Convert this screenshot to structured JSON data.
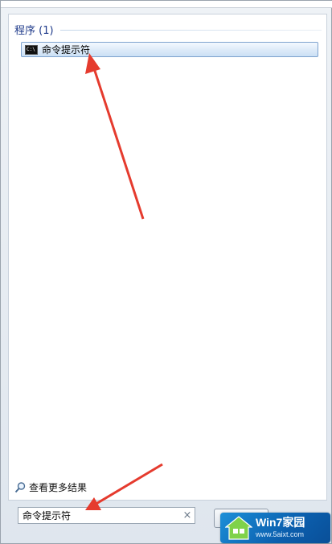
{
  "results": {
    "group_title": "程序 (1)",
    "items": [
      {
        "label": "命令提示符",
        "icon": "cmd-icon"
      }
    ]
  },
  "see_more": {
    "label": "查看更多结果",
    "icon": "search-icon"
  },
  "search": {
    "value": "命令提示符",
    "clear_symbol": "×"
  },
  "watermark": {
    "title": "Win7家园",
    "url": "www.5aixt.com"
  },
  "colors": {
    "group_title": "#1e3a8a",
    "selection_border": "#7da2ce",
    "arrow": "#e53b2e",
    "watermark_bg": "#0b5fae"
  }
}
